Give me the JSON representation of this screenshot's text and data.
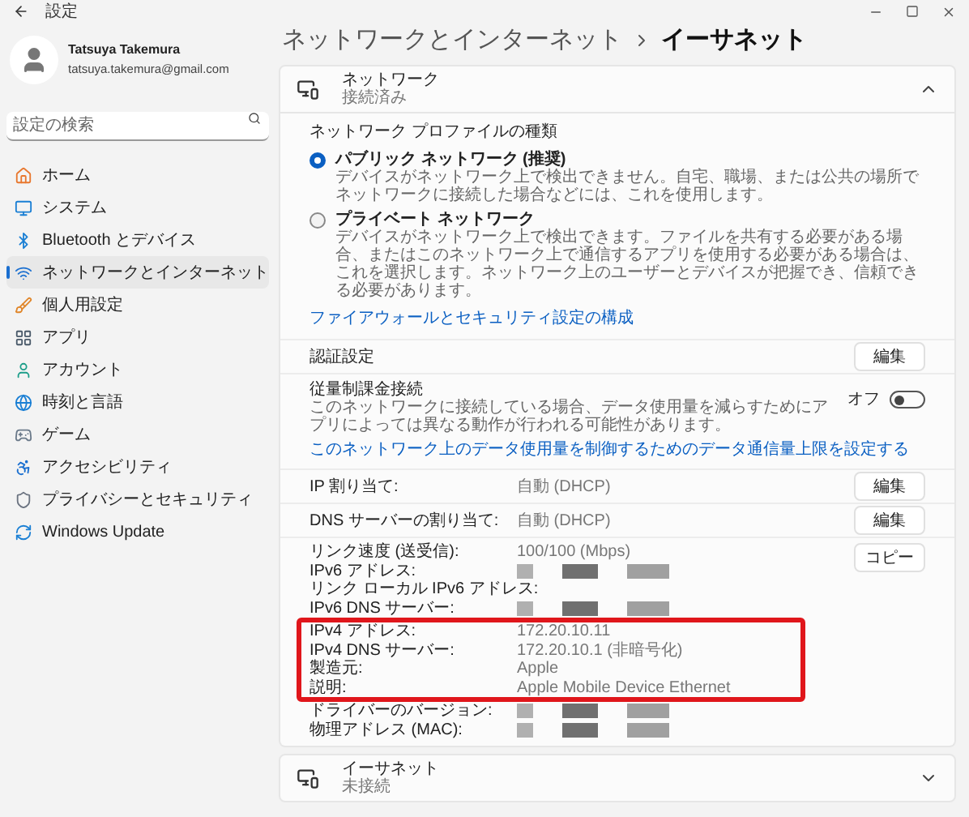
{
  "window": {
    "title": "設定"
  },
  "user": {
    "name": "Tatsuya Takemura",
    "email": "tatsuya.takemura@gmail.com"
  },
  "search": {
    "placeholder": "設定の検索"
  },
  "sidebar": {
    "items": [
      {
        "label": "ホーム",
        "selected": false
      },
      {
        "label": "システム",
        "selected": false
      },
      {
        "label": "Bluetooth とデバイス",
        "selected": false
      },
      {
        "label": "ネットワークとインターネット",
        "selected": true
      },
      {
        "label": "個人用設定",
        "selected": false
      },
      {
        "label": "アプリ",
        "selected": false
      },
      {
        "label": "アカウント",
        "selected": false
      },
      {
        "label": "時刻と言語",
        "selected": false
      },
      {
        "label": "ゲーム",
        "selected": false
      },
      {
        "label": "アクセシビリティ",
        "selected": false
      },
      {
        "label": "プライバシーとセキュリティ",
        "selected": false
      },
      {
        "label": "Windows Update",
        "selected": false
      }
    ]
  },
  "breadcrumb": [
    "ネットワークとインターネット",
    "イーサネット"
  ],
  "network_card": {
    "title": "ネットワーク",
    "status": "接続済み",
    "expanded": true,
    "profile": {
      "label": "ネットワーク プロファイルの種類",
      "options": [
        {
          "title": "パブリック ネットワーク (推奨)",
          "description": "デバイスがネットワーク上で検出できません。自宅、職場、または公共の場所でネットワークに接続した場合などには、これを使用します。",
          "selected": true
        },
        {
          "title": "プライベート ネットワーク",
          "description": "デバイスがネットワーク上で検出できます。ファイルを共有する必要がある場合、またはこのネットワーク上で通信するアプリを使用する必要がある場合は、これを選択します。ネットワーク上のユーザーとデバイスが把握でき、信頼できる必要があります。",
          "selected": false
        }
      ]
    },
    "firewall_link": "ファイアウォールとセキュリティ設定の構成",
    "auth": {
      "label": "認証設定",
      "button": "編集"
    },
    "metered": {
      "label": "従量制課金接続",
      "description": "このネットワークに接続している場合、データ使用量を減らすためにアプリによっては異なる動作が行われる可能性があります。",
      "toggle_label": "オフ",
      "on": false,
      "link": "このネットワーク上のデータ使用量を制御するためのデータ通信量上限を設定する"
    },
    "ip": {
      "label": "IP 割り当て:",
      "value": "自動 (DHCP)",
      "button": "編集"
    },
    "dns": {
      "label": "DNS サーバーの割り当て:",
      "value": "自動 (DHCP)",
      "button": "編集"
    },
    "copy_button": "コピー",
    "properties": [
      {
        "label": "リンク速度 (送受信):",
        "kind": "text",
        "value": "100/100 (Mbps)",
        "highlighted": false
      },
      {
        "label": "IPv6 アドレス:",
        "kind": "redacted",
        "highlighted": false
      },
      {
        "label": "リンク ローカル IPv6 アドレス:",
        "kind": "empty",
        "highlighted": false
      },
      {
        "label": "IPv6 DNS サーバー:",
        "kind": "redacted",
        "highlighted": false
      },
      {
        "label": "IPv4 アドレス:",
        "kind": "text",
        "value": "172.20.10.11",
        "highlighted": true
      },
      {
        "label": "IPv4 DNS サーバー:",
        "kind": "text",
        "value": "172.20.10.1 (非暗号化)",
        "highlighted": true
      },
      {
        "label": "製造元:",
        "kind": "text",
        "value": "Apple",
        "highlighted": true
      },
      {
        "label": "説明:",
        "kind": "text",
        "value": "Apple Mobile Device Ethernet",
        "highlighted": true
      },
      {
        "label": "ドライバーのバージョン:",
        "kind": "redacted",
        "highlighted": false
      },
      {
        "label": "物理アドレス (MAC):",
        "kind": "redacted",
        "highlighted": false
      }
    ]
  },
  "ethernet_card": {
    "title": "イーサネット",
    "status": "未接続",
    "expanded": false
  }
}
